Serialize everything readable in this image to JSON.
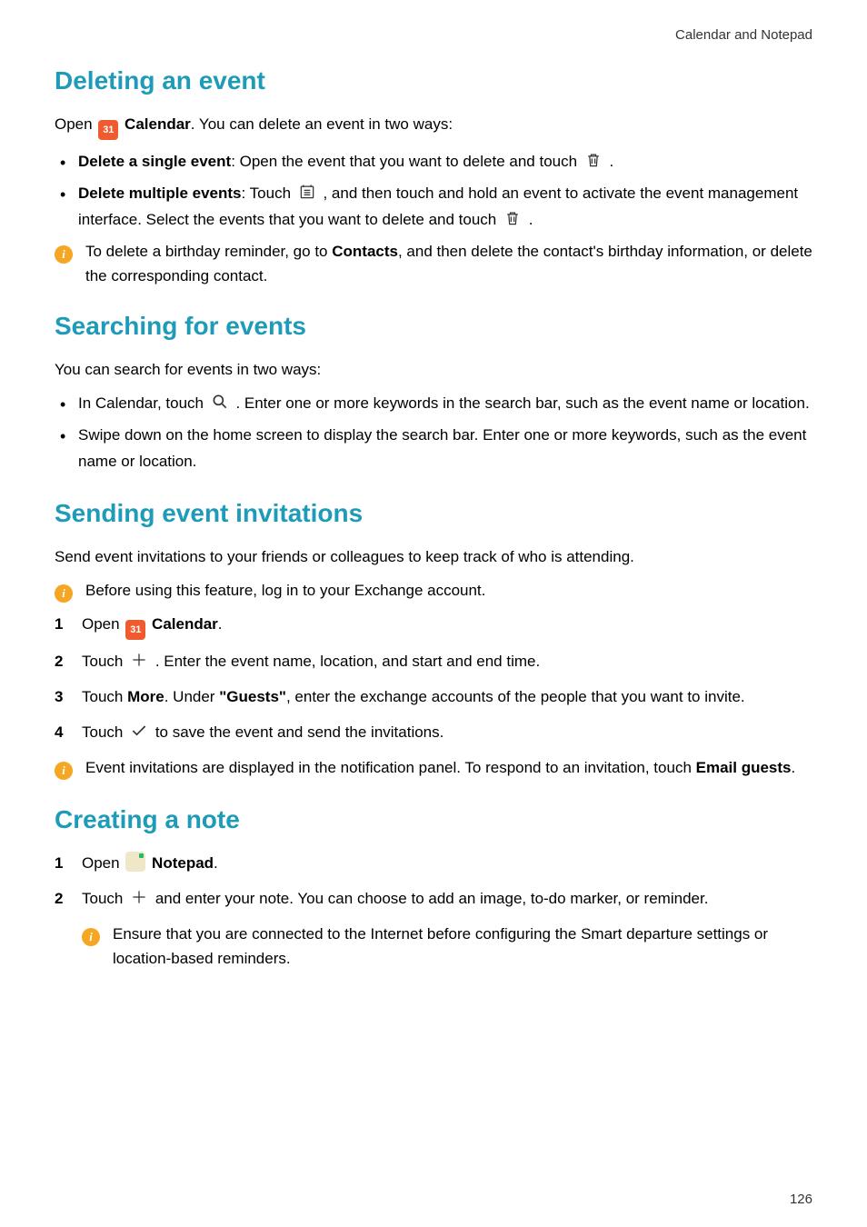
{
  "header": "Calendar and Notepad",
  "page_number": "126",
  "icons": {
    "calendar_app_text": "31",
    "info_glyph": "i"
  },
  "s1": {
    "heading": "Deleting an event",
    "intro_prefix": "Open ",
    "calendar_label": "Calendar",
    "intro_suffix": ". You can delete an event in two ways:",
    "b1_strong": "Delete a single event",
    "b1_text_a": ": Open the event that you want to delete and touch ",
    "b1_text_b": " .",
    "b2_strong": "Delete multiple events",
    "b2_text_a": ": Touch ",
    "b2_text_b": " , and then touch and hold an event to activate the event management interface. Select the events that you want to delete and touch ",
    "b2_text_c": " .",
    "info_a": "To delete a birthday reminder, go to ",
    "info_bold": "Contacts",
    "info_b": ", and then delete the contact's birthday information, or delete the corresponding contact."
  },
  "s2": {
    "heading": "Searching for events",
    "intro": "You can search for events in two ways:",
    "b1_a": "In Calendar, touch ",
    "b1_b": " . Enter one or more keywords in the search bar, such as the event name or location.",
    "b2": "Swipe down on the home screen to display the search bar. Enter one or more keywords, such as the event name or location."
  },
  "s3": {
    "heading": "Sending event invitations",
    "intro": "Send event invitations to your friends or colleagues to keep track of who is attending.",
    "info1": "Before using this feature, log in to your Exchange account.",
    "step1_prefix": "Open ",
    "calendar_label": "Calendar",
    "step1_suffix": ".",
    "step2_a": "Touch ",
    "step2_b": " . Enter the event name, location, and start and end time.",
    "step3_a": "Touch ",
    "step3_bold1": "More",
    "step3_b": ". Under ",
    "step3_bold2": "\"Guests\"",
    "step3_c": ", enter the exchange accounts of the people that you want to invite.",
    "step4_a": "Touch ",
    "step4_b": " to save the event and send the invitations.",
    "info2_a": "Event invitations are displayed in the notification panel. To respond to an invitation, touch ",
    "info2_bold": "Email guests",
    "info2_b": "."
  },
  "s4": {
    "heading": "Creating a note",
    "step1_prefix": "Open ",
    "notepad_label": "Notepad",
    "step1_suffix": ".",
    "step2_a": "Touch ",
    "step2_b": " and enter your note. You can choose to add an image, to-do marker, or reminder.",
    "info_text": "Ensure that you are connected to the Internet before configuring the Smart departure settings or location-based reminders."
  }
}
